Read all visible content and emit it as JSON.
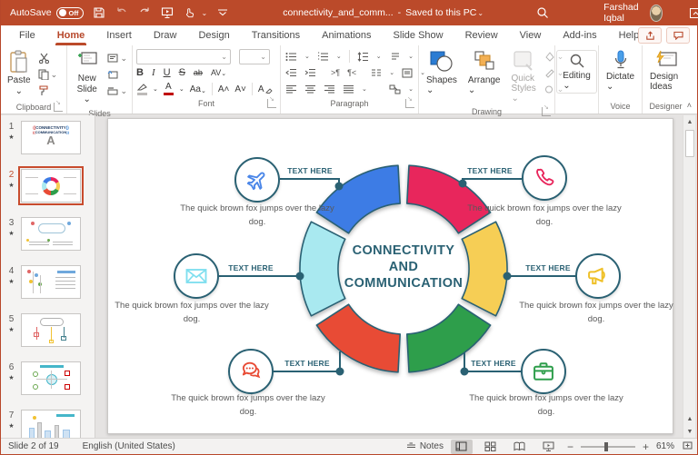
{
  "titlebar": {
    "autosave_label": "AutoSave",
    "autosave_state": "Off",
    "filename": "connectivity_and_comm...",
    "saved_status": "Saved to this PC",
    "user_name": "Farshad Iqbal"
  },
  "tabs": {
    "active": "Home",
    "items": [
      {
        "label": "File"
      },
      {
        "label": "Home"
      },
      {
        "label": "Insert"
      },
      {
        "label": "Draw"
      },
      {
        "label": "Design"
      },
      {
        "label": "Transitions"
      },
      {
        "label": "Animations"
      },
      {
        "label": "Slide Show"
      },
      {
        "label": "Review"
      },
      {
        "label": "View"
      },
      {
        "label": "Add-ins"
      },
      {
        "label": "Help"
      }
    ]
  },
  "ribbon": {
    "clipboard": {
      "paste_label": "Paste",
      "group_label": "Clipboard"
    },
    "slides": {
      "new_slide_label": "New Slide",
      "group_label": "Slides"
    },
    "font": {
      "bold": "B",
      "italic": "I",
      "underline": "U",
      "strikethrough": "S",
      "spacing": "AV",
      "case": "Aa",
      "grow": "A˄",
      "shrink": "A˅",
      "clear": "A",
      "color_letter": "A",
      "group_label": "Font"
    },
    "paragraph": {
      "group_label": "Paragraph"
    },
    "drawing": {
      "shapes_label": "Shapes",
      "arrange_label": "Arrange",
      "quick_styles_label": "Quick Styles",
      "group_label": "Drawing"
    },
    "editing": {
      "label": "Editing"
    },
    "voice": {
      "dictate_label": "Dictate",
      "group_label": "Voice"
    },
    "designer": {
      "design_ideas_label": "Design Ideas",
      "group_label": "Designer"
    }
  },
  "thumbnails": [
    {
      "number": "1",
      "art_text": [
        "CONNECTIVITY",
        "COMMUNICATION"
      ]
    },
    {
      "number": "2",
      "selected": true
    },
    {
      "number": "3"
    },
    {
      "number": "4"
    },
    {
      "number": "5"
    },
    {
      "number": "6"
    },
    {
      "number": "7"
    }
  ],
  "slide": {
    "title_lines": [
      "CONNECTIVITY",
      "AND",
      "COMMUNICATION"
    ],
    "accent_color": "#2A6173",
    "segments": [
      {
        "name": "top-right",
        "color": "#E8255B"
      },
      {
        "name": "right",
        "color": "#F6CE55"
      },
      {
        "name": "bottom-right",
        "color": "#2E9E4B"
      },
      {
        "name": "bottom-left",
        "color": "#E84B35"
      },
      {
        "name": "left",
        "color": "#A9E9F0"
      },
      {
        "name": "top-left",
        "color": "#3D7BE5"
      }
    ],
    "items": [
      {
        "icon": "airplane",
        "color": "#4A86E8",
        "label": "TEXT HERE",
        "caption": "The quick brown fox jumps over the lazy dog."
      },
      {
        "icon": "phone",
        "color": "#E8255B",
        "label": "TEXT HERE",
        "caption": "The quick brown fox jumps over the lazy dog."
      },
      {
        "icon": "envelope",
        "color": "#7FDFEF",
        "label": "TEXT HERE",
        "caption": "The quick brown fox jumps over the lazy dog."
      },
      {
        "icon": "megaphone",
        "color": "#EFC028",
        "label": "TEXT HERE",
        "caption": "The quick brown fox jumps over the lazy dog."
      },
      {
        "icon": "chat",
        "color": "#E84B35",
        "label": "TEXT HERE",
        "caption": "The quick brown fox jumps over the lazy dog."
      },
      {
        "icon": "briefcase",
        "color": "#2E9E4B",
        "label": "TEXT HERE",
        "caption": "The quick brown fox jumps over the lazy dog."
      }
    ]
  },
  "statusbar": {
    "slide_indicator": "Slide 2 of 19",
    "language": "English (United States)",
    "notes_label": "Notes",
    "zoom_level": "61%"
  }
}
